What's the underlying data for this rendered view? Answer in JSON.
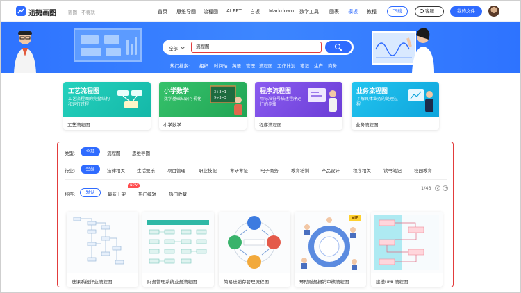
{
  "header": {
    "logo_text": "迅捷画图",
    "logo_sub": "鶴图 · 不将就",
    "nav": [
      "首页",
      "思维导图",
      "流程图",
      "AI PPT",
      "白板",
      "Markdown",
      "数学工具",
      "图表",
      "模板",
      "教程"
    ],
    "active_nav": "模板",
    "download_label": "下载",
    "service_label": "客服",
    "files_label": "我的文件"
  },
  "search": {
    "scope": "全部",
    "value": "流程图",
    "hot_label": "热门搜索:",
    "hot": [
      "组织",
      "时间轴",
      "英语",
      "管理",
      "流程图",
      "工作计划",
      "笔记",
      "生产",
      "商务"
    ]
  },
  "categories": [
    {
      "title": "工艺流程图",
      "desc": "工艺流程图的完整结构和运行过程",
      "name": "工艺流程图",
      "color": "#1fc8b6"
    },
    {
      "title": "小学数学",
      "desc": "数学基础知识可视化",
      "name": "小学数学",
      "color": "#2db35f"
    },
    {
      "title": "程序流程图",
      "desc": "用标准符号描述程序运行的步骤",
      "name": "程序流程图",
      "color": "#7b4de0"
    },
    {
      "title": "业务流程图",
      "desc": "了解具体业务的处理过程",
      "name": "业务流程图",
      "color": "#16b6e8"
    }
  ],
  "filters": {
    "type_label": "类型:",
    "types": [
      "全部",
      "流程图",
      "思维导图"
    ],
    "industry_label": "行业:",
    "industries": [
      "全部",
      "法律相关",
      "生活娱乐",
      "项目管理",
      "职业技能",
      "考研考证",
      "电子商务",
      "教育培训",
      "产品设计",
      "程序相关",
      "读书笔记",
      "校园教育"
    ],
    "sort_label": "排序:",
    "sorts": [
      "默认",
      "最新上架",
      "热门编辑",
      "热门收藏"
    ],
    "new_badge": "NEW",
    "pager": "1/43"
  },
  "templates": [
    {
      "name": "选课系统作业流程图",
      "vip": false
    },
    {
      "name": "财务管理系统业务流程图",
      "vip": false
    },
    {
      "name": "简易进销存管理流程图",
      "vip": false
    },
    {
      "name": "环形财务报销审核流程图",
      "vip": true,
      "vip_label": "VIP"
    },
    {
      "name": "建模UML流程图",
      "vip": false
    }
  ]
}
